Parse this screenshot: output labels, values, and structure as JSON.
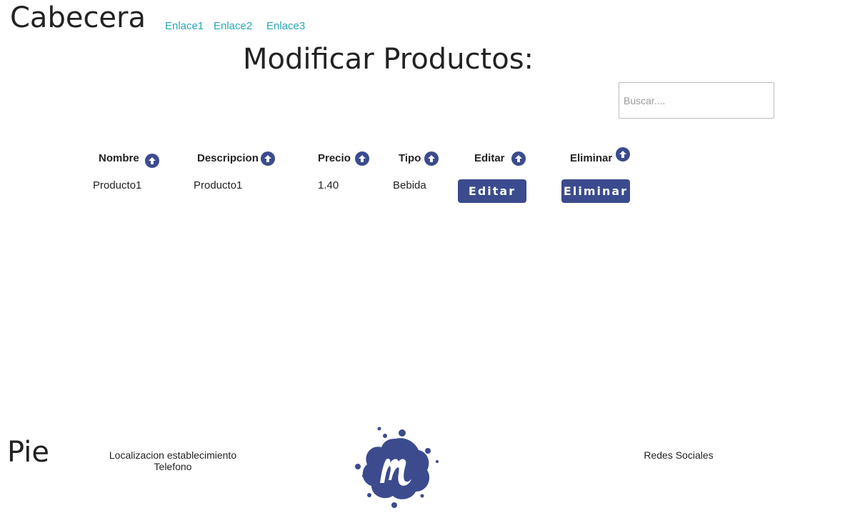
{
  "header": {
    "title": "Cabecera",
    "links": [
      "Enlace1",
      "Enlace2",
      "Enlace3"
    ]
  },
  "main": {
    "title": "Modificar Productos:",
    "search": {
      "placeholder": "Buscar....",
      "value": ""
    },
    "table": {
      "columns": [
        "Nombre",
        "Descripcion",
        "Precio",
        "Tipo",
        "Editar",
        "Eliminar"
      ],
      "rows": [
        {
          "nombre": "Producto1",
          "descripcion": "Producto1",
          "precio": "1.40",
          "tipo": "Bebida",
          "edit_label": "Editar",
          "delete_label": "Eliminar"
        }
      ]
    }
  },
  "footer": {
    "title": "Pie",
    "location": "Localizacion establecimiento",
    "phone": "Telefono",
    "social": "Redes Sociales"
  },
  "colors": {
    "accent": "#3b4b8e",
    "link": "#2aa4b8"
  },
  "icons": {
    "sort": "arrow-up-circle-icon",
    "logo": "meetup-style-logo"
  }
}
